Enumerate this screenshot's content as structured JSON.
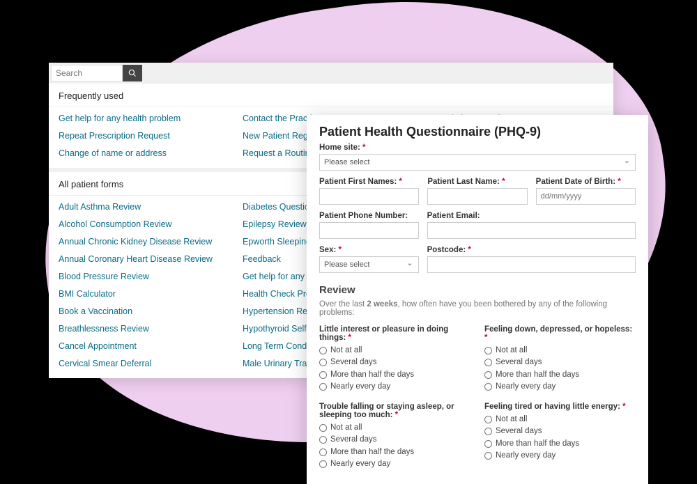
{
  "search": {
    "placeholder": "Search"
  },
  "sections": {
    "frequent_title": "Frequently used",
    "all_title": "All patient forms"
  },
  "frequent_links": {
    "c1": [
      "Get help for any health problem",
      "Repeat Prescription Request",
      "Change of name or address"
    ],
    "c2": [
      "Contact the Practice",
      "New Patient Registration",
      "Request a Routine Appointment"
    ],
    "c3": [
      "Prescription Question"
    ]
  },
  "all_links": {
    "c1": [
      "Adult Asthma Review",
      "Alcohol Consumption Review",
      "Annual Chronic Kidney Disease Review",
      "Annual Coronary Heart Disease Review",
      "Blood Pressure Review",
      "BMI Calculator",
      "Book a Vaccination",
      "Breathlessness Review",
      "Cancel Appointment",
      "Cervical Smear Deferral"
    ],
    "c2": [
      "Diabetes Questionnaire",
      "Epilepsy Review",
      "Epworth Sleepiness Scale",
      "Feedback",
      "Get help for any health problem",
      "Health Check Pre-Assessment Que",
      "Hypertension Review Questionnai",
      "Hypothyroid Self Assessment",
      "Long Term Conditions Synchronisat",
      "Male Urinary Tract (IPSS)"
    ]
  },
  "form": {
    "title": "Patient Health Questionnaire (PHQ-9)",
    "home_site_label": "Home site:",
    "please_select": "Please select",
    "first_name_label": "Patient First Names:",
    "last_name_label": "Patient Last Name:",
    "dob_label": "Patient Date of Birth:",
    "dob_placeholder": "dd/mm/yyyy",
    "phone_label": "Patient Phone Number:",
    "email_label": "Patient Email:",
    "sex_label": "Sex:",
    "postcode_label": "Postcode:",
    "review_title": "Review",
    "review_intro_a": "Over the last ",
    "review_intro_b": "2 weeks",
    "review_intro_c": ", how often have you been bothered by any of the following problems:",
    "q1": "Little interest or pleasure in doing things:",
    "q2": "Feeling down, depressed, or hopeless:",
    "q3": "Trouble falling or staying asleep, or sleeping too much:",
    "q4": "Feeling tired or having little energy:",
    "opts": [
      "Not at all",
      "Several days",
      "More than half the days",
      "Nearly every day"
    ]
  }
}
